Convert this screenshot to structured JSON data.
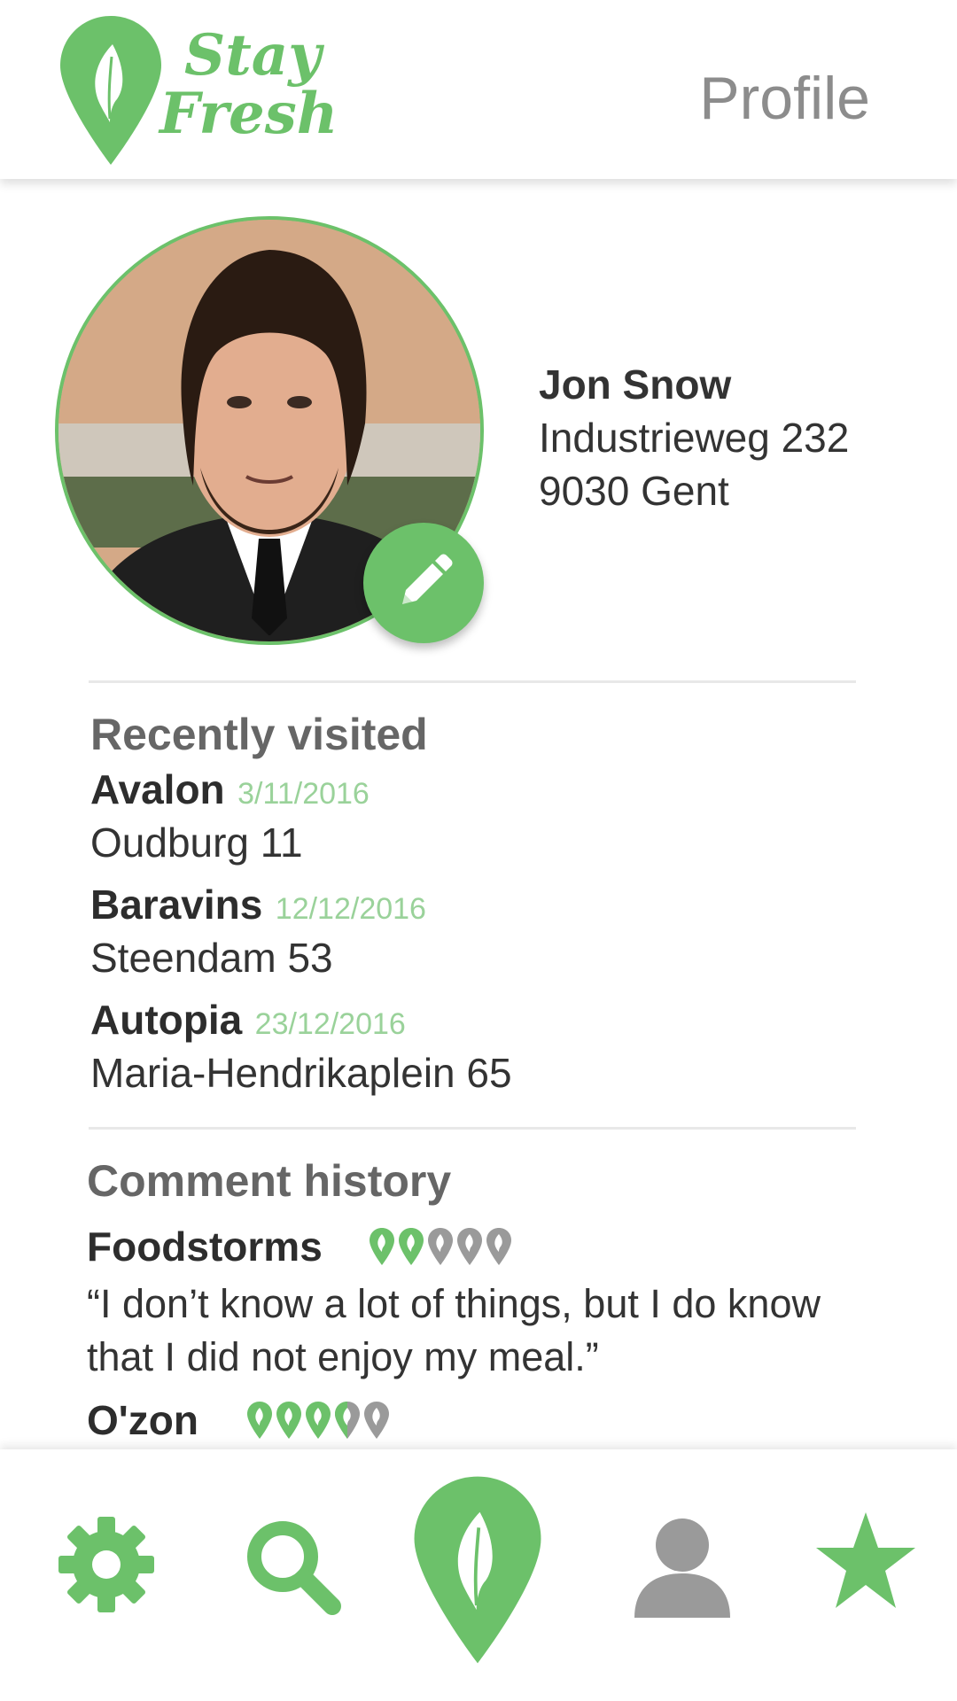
{
  "header": {
    "logo_line1": "Stay",
    "logo_line2": "Fresh",
    "title": "Profile"
  },
  "profile": {
    "name": "Jon Snow",
    "street": "Industrieweg 232",
    "city": "9030 Gent",
    "edit_icon": "pencil-icon"
  },
  "recent": {
    "title": "Recently visited",
    "items": [
      {
        "name": "Avalon",
        "date": "3/11/2016",
        "address": "Oudburg 11"
      },
      {
        "name": "Baravins",
        "date": "12/12/2016",
        "address": "Steendam 53"
      },
      {
        "name": "Autopia",
        "date": "23/12/2016",
        "address": "Maria-Hendrikaplein 65"
      }
    ]
  },
  "comments": {
    "title": "Comment history",
    "items": [
      {
        "name": "Foodstorms",
        "rating": 2,
        "max": 5,
        "text": "“I don’t know a lot of things, but I do know that I did not enjoy my meal.”"
      },
      {
        "name": "O'zon",
        "rating": 3.5,
        "max": 5,
        "text": ""
      }
    ]
  },
  "nav": {
    "items": [
      "gear-icon",
      "search-icon",
      "leaf-pin-icon",
      "user-icon",
      "star-icon"
    ],
    "active": "user-icon"
  },
  "colors": {
    "accent": "#6cc16a",
    "inactive": "#9a9a9a",
    "date": "#9ad29a"
  }
}
